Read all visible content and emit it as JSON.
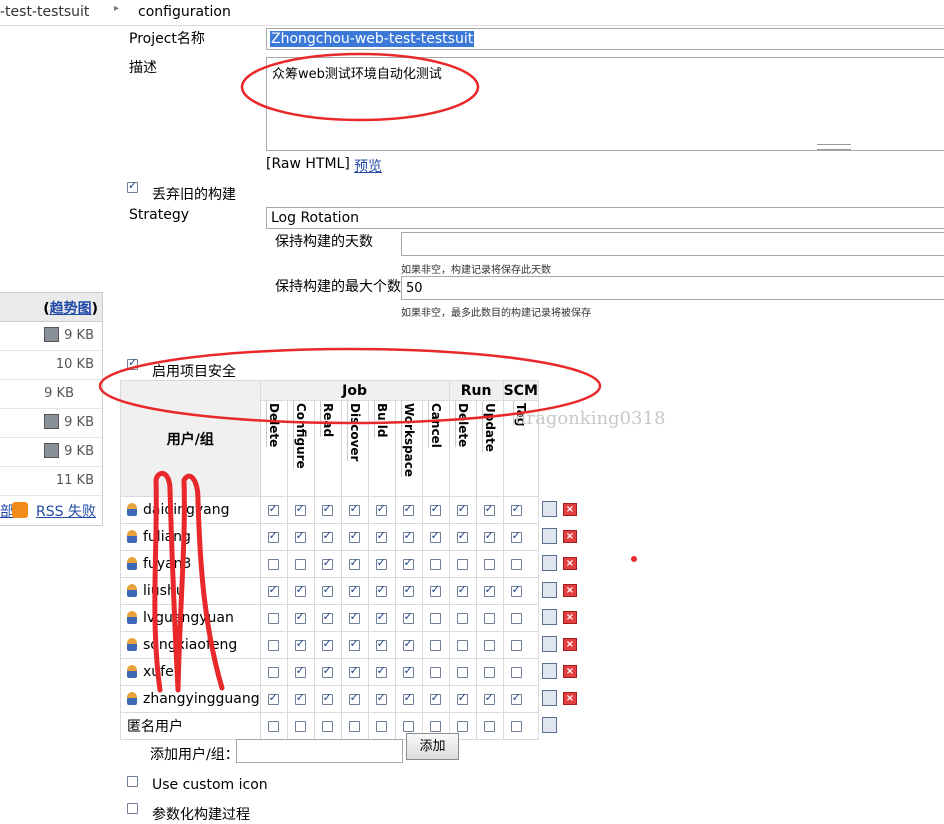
{
  "breadcrumb": {
    "project": "-test-testsuit",
    "separator": "▸",
    "page": "configuration"
  },
  "project": {
    "name_label": "Project名称",
    "name_value": "Zhongchou-web-test-testsuit",
    "desc_label": "描述",
    "desc_value": "众筹web测试环境自动化测试",
    "raw_html": "[Raw HTML]",
    "preview": "预览"
  },
  "discard": {
    "label": "丢弃旧的构建",
    "strategy_label": "Strategy",
    "strategy_value": "Log Rotation",
    "days_label": "保持构建的天数",
    "days_value": "",
    "days_help": "如果非空，构建记录将保存此天数",
    "max_label": "保持构建的最大个数",
    "max_value": "50",
    "max_help": "如果非空，最多此数目的构建记录将被保存"
  },
  "sidebar": {
    "trend_link": "趋势图",
    "sizes": [
      "9 KB",
      "10 KB",
      "9 KB",
      "9 KB",
      "9 KB",
      "11 KB"
    ],
    "partial_link": "部",
    "rss_fail": "RSS 失败"
  },
  "security": {
    "label": "启用项目安全",
    "user_header": "用户/组",
    "groups": [
      {
        "name": "Job"
      },
      {
        "name": "Run"
      },
      {
        "name": "SCM"
      }
    ],
    "perms": [
      "Delete",
      "Configure",
      "Read",
      "Discover",
      "Build",
      "Workspace",
      "Cancel",
      "Delete",
      "Update",
      "Tag"
    ],
    "users": [
      {
        "name": "daiqingyang",
        "checks": [
          true,
          true,
          true,
          true,
          true,
          true,
          true,
          true,
          true,
          true
        ],
        "deletable": true
      },
      {
        "name": "fuliang",
        "checks": [
          true,
          true,
          true,
          true,
          true,
          true,
          true,
          true,
          true,
          true
        ],
        "deletable": true
      },
      {
        "name": "fuyan3",
        "checks": [
          false,
          false,
          true,
          true,
          true,
          true,
          false,
          false,
          false,
          false
        ],
        "deletable": true
      },
      {
        "name": "liushu",
        "checks": [
          true,
          true,
          true,
          true,
          true,
          true,
          true,
          true,
          true,
          true
        ],
        "deletable": true
      },
      {
        "name": "lvguangyuan",
        "checks": [
          false,
          true,
          true,
          true,
          true,
          true,
          false,
          false,
          false,
          false
        ],
        "deletable": true
      },
      {
        "name": "songxiaofeng",
        "checks": [
          false,
          true,
          true,
          true,
          true,
          true,
          false,
          false,
          false,
          false
        ],
        "deletable": true
      },
      {
        "name": "xufei",
        "checks": [
          false,
          true,
          true,
          true,
          true,
          true,
          false,
          false,
          false,
          false
        ],
        "deletable": true
      },
      {
        "name": "zhangyingguang",
        "checks": [
          true,
          true,
          true,
          true,
          true,
          true,
          true,
          true,
          true,
          true
        ],
        "deletable": true
      },
      {
        "name": "匿名用户",
        "checks": [
          false,
          false,
          false,
          false,
          false,
          false,
          false,
          false,
          false,
          false
        ],
        "deletable": false,
        "anonymous": true
      }
    ],
    "add_label": "添加用户/组：",
    "add_value": "",
    "add_button": "添加"
  },
  "watermark": "dragonking0318",
  "options": [
    {
      "label": "Use custom icon",
      "checked": false
    },
    {
      "label": "参数化构建过程",
      "checked": false
    }
  ],
  "colors": {
    "highlight": "#3b78d8",
    "annotation": "#e8282b",
    "link": "#2149a6"
  }
}
